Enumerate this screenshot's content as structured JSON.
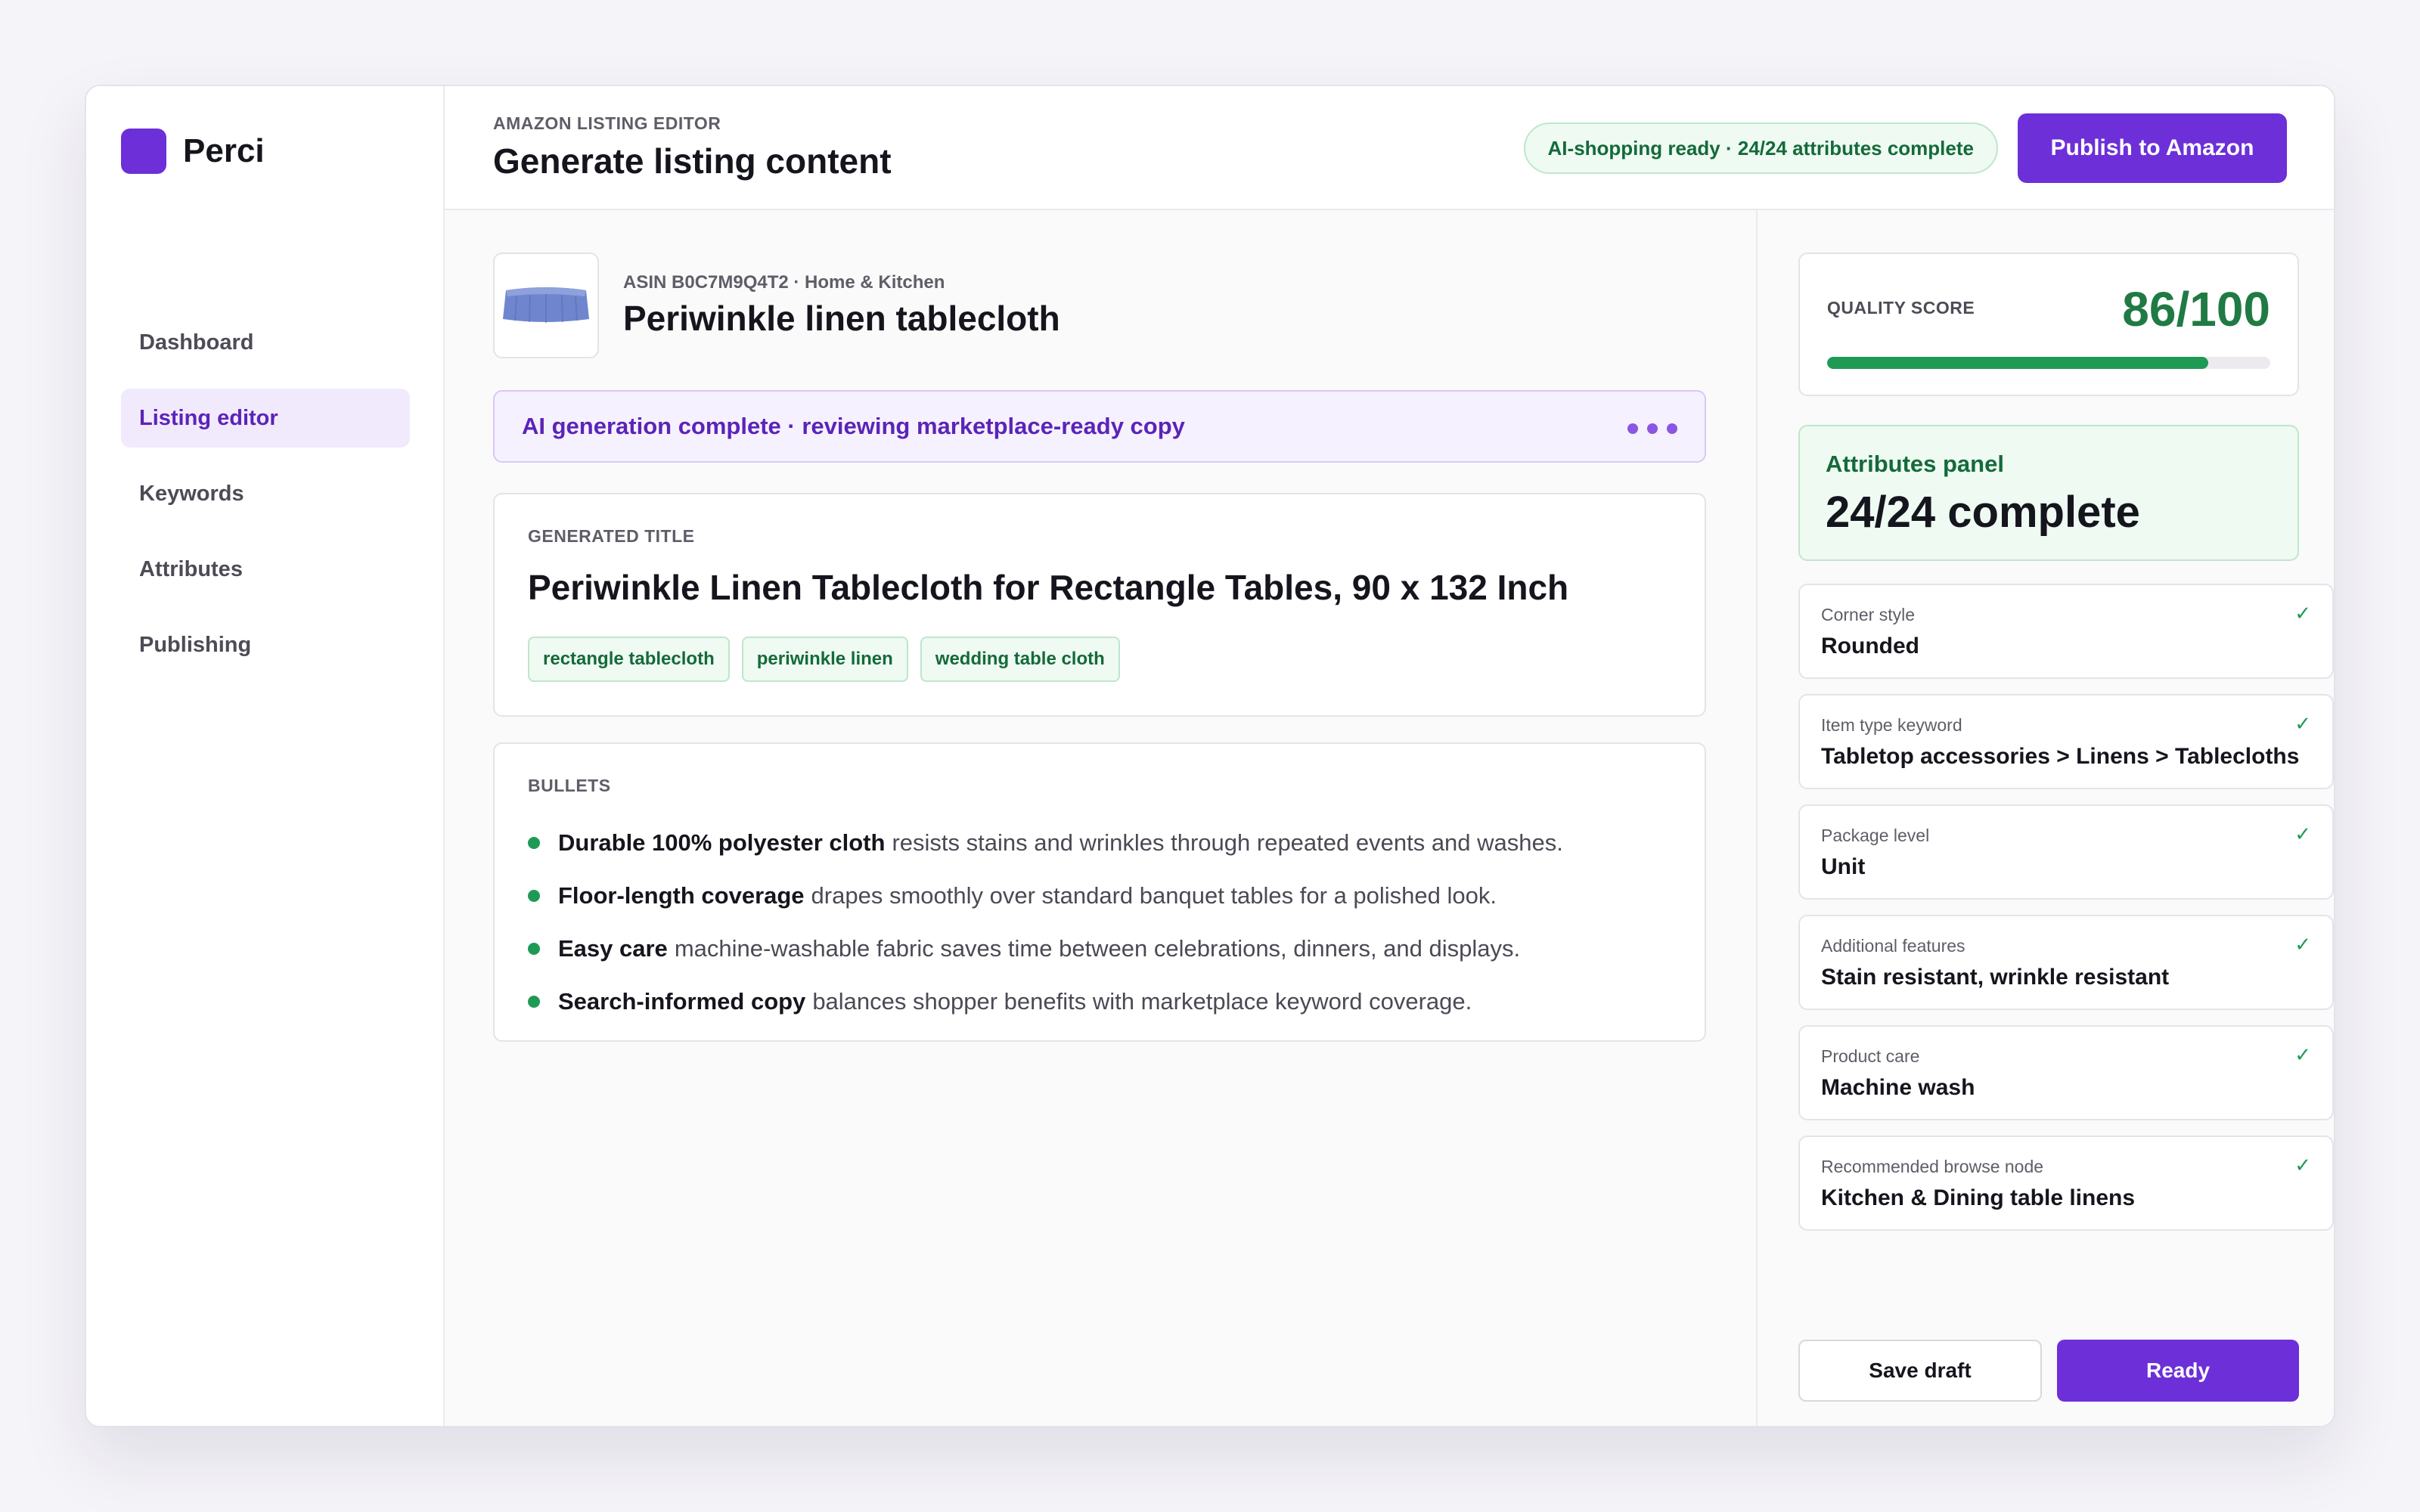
{
  "brand": {
    "name": "Perci"
  },
  "sidebar": {
    "items": [
      {
        "label": "Dashboard",
        "active": false
      },
      {
        "label": "Listing editor",
        "active": true
      },
      {
        "label": "Keywords",
        "active": false
      },
      {
        "label": "Attributes",
        "active": false
      },
      {
        "label": "Publishing",
        "active": false
      }
    ]
  },
  "header": {
    "eyebrow": "AMAZON LISTING EDITOR",
    "title": "Generate listing content",
    "status_pill": "AI-shopping ready · 24/24 attributes complete",
    "publish_label": "Publish to Amazon"
  },
  "product": {
    "meta": "ASIN B0C7M9Q4T2 · Home & Kitchen",
    "name": "Periwinkle linen tablecloth"
  },
  "ai_banner": {
    "text": "AI generation complete · reviewing marketplace-ready copy"
  },
  "generated_title": {
    "label": "GENERATED TITLE",
    "text": "Periwinkle Linen Tablecloth for Rectangle Tables, 90 x 132 Inch",
    "tags": [
      "rectangle tablecloth",
      "periwinkle linen",
      "wedding table cloth"
    ]
  },
  "bullets": {
    "label": "BULLETS",
    "items": [
      {
        "strong": "Durable 100% polyester cloth",
        "rest": "resists stains and wrinkles through repeated events and washes."
      },
      {
        "strong": "Floor-length coverage",
        "rest": "drapes smoothly over standard banquet tables for a polished look."
      },
      {
        "strong": "Easy care",
        "rest": "machine-washable fabric saves time between celebrations, dinners, and displays."
      },
      {
        "strong": "Search-informed copy",
        "rest": "balances shopper benefits with marketplace keyword coverage."
      }
    ]
  },
  "quality": {
    "label": "QUALITY SCORE",
    "value": "86/100",
    "fraction": 0.86
  },
  "attributes_panel": {
    "title": "Attributes panel",
    "count": "24/24 complete",
    "items": [
      {
        "key": "Corner style",
        "value": "Rounded"
      },
      {
        "key": "Item type keyword",
        "value": "Tabletop accessories > Linens > Tablecloths"
      },
      {
        "key": "Package level",
        "value": "Unit"
      },
      {
        "key": "Additional features",
        "value": "Stain resistant, wrinkle resistant"
      },
      {
        "key": "Product care",
        "value": "Machine wash"
      },
      {
        "key": "Recommended browse node",
        "value": "Kitchen & Dining table linens"
      }
    ],
    "check_glyph": "✓"
  },
  "actions": {
    "save_label": "Save draft",
    "ready_label": "Ready"
  },
  "icons": {
    "brand": "brand-logo-icon",
    "check": "check-icon",
    "more": "more-dots-icon"
  },
  "colors": {
    "accent": "#6d2fd8",
    "success": "#1f9a55",
    "success_bg": "#eefaf2"
  }
}
